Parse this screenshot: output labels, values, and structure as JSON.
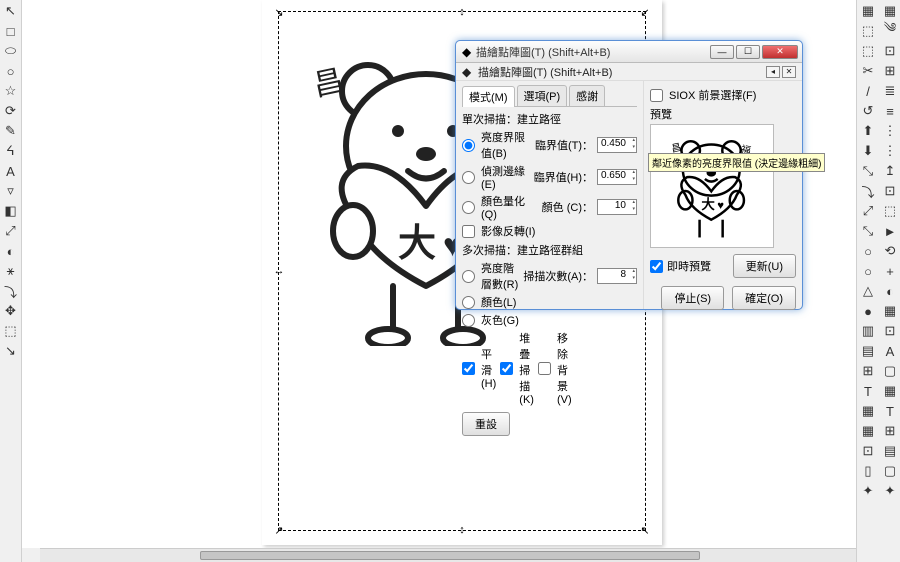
{
  "dialog": {
    "title": "描繪點陣圖(T) (Shift+Alt+B)",
    "subtitle": "描繪點陣圖(T) (Shift+Alt+B)",
    "tabs": {
      "mode": "模式(M)",
      "options": "選項(P)",
      "thanks": "感謝"
    },
    "siox": "SIOX 前景選擇(F)",
    "single_title": "單次掃描：建立路徑",
    "brightness": "亮度界限值(B)",
    "threshold": "臨界值(T)：",
    "threshold_val": "0.450",
    "edge": "偵測邊緣(E)",
    "edge_threshold": "臨界值(H)：",
    "edge_val": "0.650",
    "quantize": "顏色量化(Q)",
    "colors": "顏色 (C)：",
    "colors_val": "10",
    "invert": "影像反轉(I)",
    "multi_title": "多次掃描：建立路徑群組",
    "brightness_levels": "亮度階層數(R)",
    "scans": "掃描次數(A)：",
    "scans_val": "8",
    "cb_colors": "顏色(L)",
    "cb_gray": "灰色(G)",
    "smooth": "平滑(H)",
    "stack": "堆疊掃描(K)",
    "remove_bg": "移除背景(V)",
    "reset": "重設",
    "preview": "預覽",
    "realtime": "即時預覽",
    "update": "更新(U)",
    "stop": "停止(S)",
    "ok": "確定(O)"
  },
  "tooltip": "鄰近像素的亮度界限值 (決定邊緣粗細)",
  "left_tools": [
    "↖",
    "□",
    "⬭",
    "○",
    "☆",
    "⟳",
    "✎",
    "ᔦ",
    "A",
    "▿",
    "◧",
    "⤢",
    "◐",
    "⚹",
    "⤵",
    "✥",
    "⬚",
    "↘"
  ],
  "right_col1": [
    "▦",
    "⬚",
    "⬚",
    "✂",
    "/",
    "↺",
    "⬆",
    "⬇",
    "⤡",
    "⤵",
    "⤢",
    "⤡",
    "○",
    "○",
    "△",
    "●",
    "▥",
    "▤",
    "⊞",
    "T",
    "▦",
    "▦",
    "⊡",
    "▯",
    "✦"
  ],
  "right_col2": [
    "▦",
    "༄",
    "⊡",
    "⊞",
    "≣",
    "≡",
    "⋮",
    "⋮",
    "↥",
    "⊡",
    "⬚",
    "►",
    "⟲",
    "+",
    "◐",
    "▦",
    "⊡",
    "A",
    "▢",
    "▦",
    "T",
    "⊞",
    "▤",
    "▢",
    "✦"
  ]
}
